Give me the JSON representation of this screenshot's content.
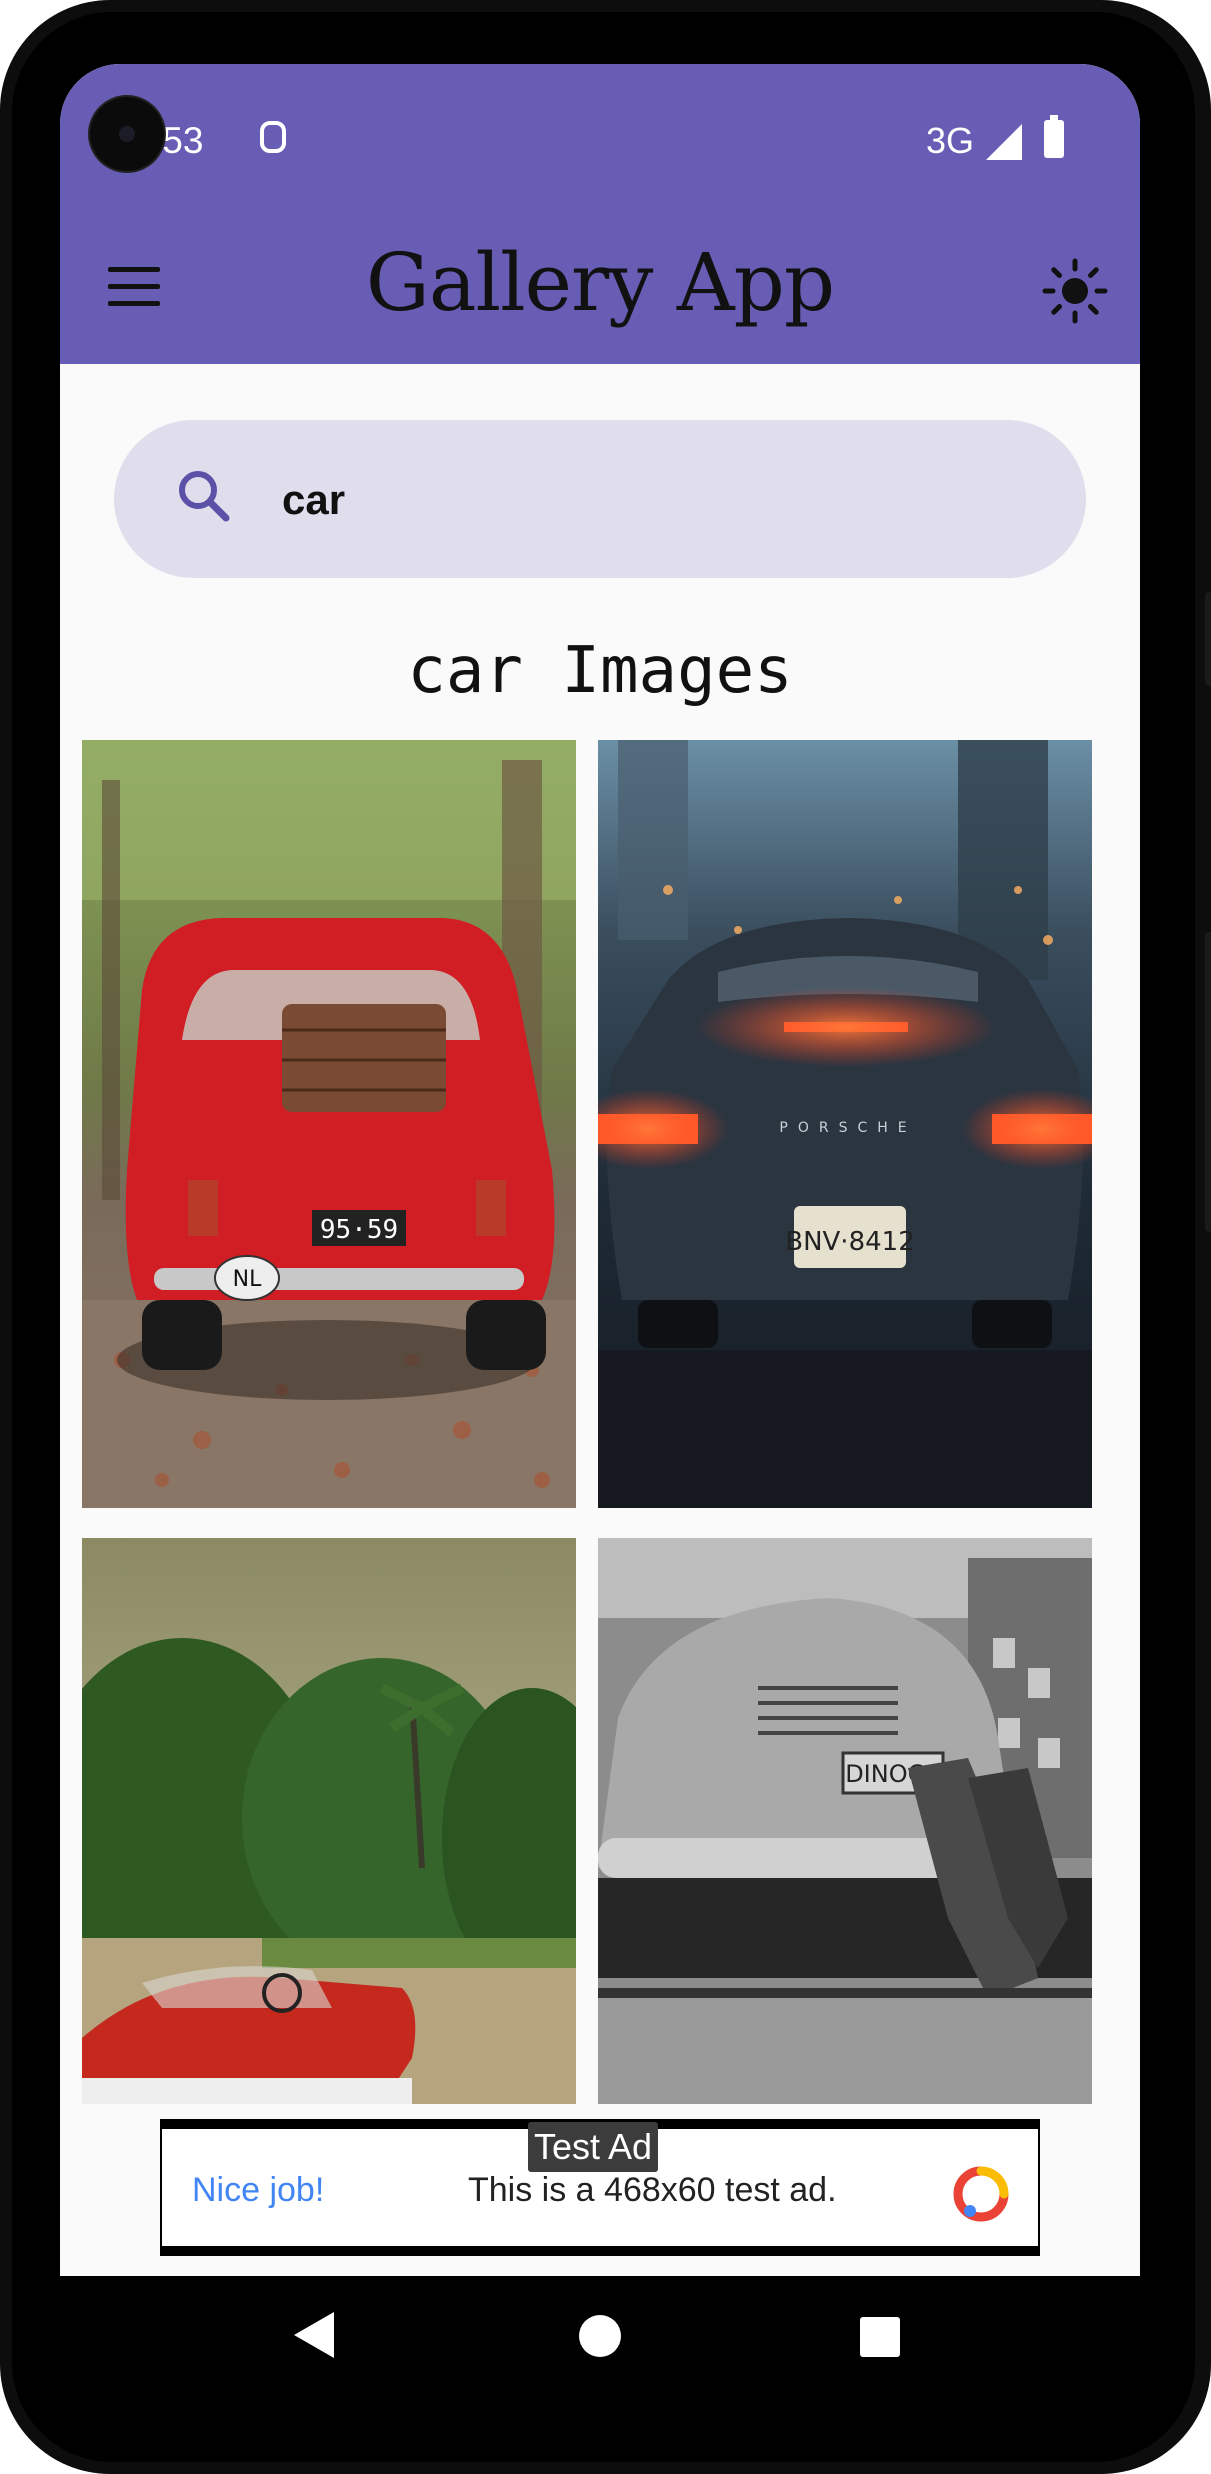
{
  "status_bar": {
    "time": ":53",
    "network": "3G",
    "icons": [
      "sim-recording-icon",
      "signal-icon",
      "battery-icon"
    ]
  },
  "app_bar": {
    "title": "Gallery App",
    "menu_icon": "hamburger-menu-icon",
    "theme_icon": "sun-icon",
    "background": "#675db5"
  },
  "search": {
    "value": "car",
    "icon": "search-icon",
    "background": "#e0ddec"
  },
  "results": {
    "title": "car Images",
    "images": [
      {
        "name": "red-fiat-with-luggage-image"
      },
      {
        "name": "porsche-911-carrera-rear-image"
      },
      {
        "name": "red-convertible-in-jungle-image"
      },
      {
        "name": "black-white-beetle-repair-image"
      }
    ]
  },
  "ad": {
    "label": "Test Ad",
    "cta": "Nice job!",
    "text": "This is a 468x60 test ad."
  },
  "nav_bar": {
    "back": "back-icon",
    "home": "home-icon",
    "recents": "recents-icon"
  }
}
